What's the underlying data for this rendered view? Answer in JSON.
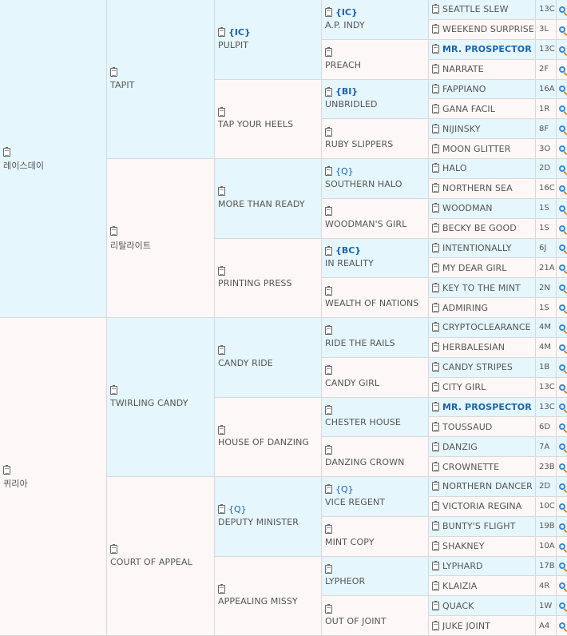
{
  "pedigree": {
    "gen1": [
      {
        "name": "레이스데이",
        "tag": ""
      },
      {
        "name": "퀴리아",
        "tag": ""
      }
    ],
    "gen2": [
      {
        "name": "TAPIT",
        "tag": ""
      },
      {
        "name": "리탈라이트",
        "tag": ""
      },
      {
        "name": "TWIRLING CANDY",
        "tag": ""
      },
      {
        "name": "COURT OF APPEAL",
        "tag": ""
      }
    ],
    "gen3": [
      {
        "name": "PULPIT",
        "tag": "{IC}"
      },
      {
        "name": "TAP YOUR HEELS",
        "tag": ""
      },
      {
        "name": "MORE THAN READY",
        "tag": ""
      },
      {
        "name": "PRINTING PRESS",
        "tag": ""
      },
      {
        "name": "CANDY RIDE",
        "tag": ""
      },
      {
        "name": "HOUSE OF DANZING",
        "tag": ""
      },
      {
        "name": "DEPUTY MINISTER",
        "tag": "{Q}"
      },
      {
        "name": "APPEALING MISSY",
        "tag": ""
      }
    ],
    "gen4": [
      {
        "name": "A.P. INDY",
        "tag": "{IC}"
      },
      {
        "name": "PREACH",
        "tag": ""
      },
      {
        "name": "UNBRIDLED",
        "tag": "{BI}"
      },
      {
        "name": "RUBY SLIPPERS",
        "tag": ""
      },
      {
        "name": "SOUTHERN HALO",
        "tag": "{Q}"
      },
      {
        "name": "WOODMAN'S GIRL",
        "tag": ""
      },
      {
        "name": "IN REALITY",
        "tag": "{BC}"
      },
      {
        "name": "WEALTH OF NATIONS",
        "tag": ""
      },
      {
        "name": "RIDE THE RAILS",
        "tag": ""
      },
      {
        "name": "CANDY GIRL",
        "tag": ""
      },
      {
        "name": "CHESTER HOUSE",
        "tag": ""
      },
      {
        "name": "DANZING CROWN",
        "tag": ""
      },
      {
        "name": "VICE REGENT",
        "tag": "{Q}"
      },
      {
        "name": "MINT COPY",
        "tag": ""
      },
      {
        "name": "LYPHEOR",
        "tag": ""
      },
      {
        "name": "OUT OF JOINT",
        "tag": ""
      }
    ],
    "gen5": [
      {
        "name": "SEATTLE SLEW",
        "code": "13C"
      },
      {
        "name": "WEEKEND SURPRISE",
        "code": "3L"
      },
      {
        "name": "MR. PROSPECTOR",
        "code": "13C",
        "highlight": true
      },
      {
        "name": "NARRATE",
        "code": "2F"
      },
      {
        "name": "FAPPIANO",
        "code": "16A"
      },
      {
        "name": "GANA FACIL",
        "code": "1R"
      },
      {
        "name": "NIJINSKY",
        "code": "8F"
      },
      {
        "name": "MOON GLITTER",
        "code": "3O"
      },
      {
        "name": "HALO",
        "code": "2D"
      },
      {
        "name": "NORTHERN SEA",
        "code": "16C"
      },
      {
        "name": "WOODMAN",
        "code": "1S"
      },
      {
        "name": "BECKY BE GOOD",
        "code": "1S"
      },
      {
        "name": "INTENTIONALLY",
        "code": "6J"
      },
      {
        "name": "MY DEAR GIRL",
        "code": "21A"
      },
      {
        "name": "KEY TO THE MINT",
        "code": "2N"
      },
      {
        "name": "ADMIRING",
        "code": "1S"
      },
      {
        "name": "CRYPTOCLEARANCE",
        "code": "4M"
      },
      {
        "name": "HERBALESIAN",
        "code": "4M"
      },
      {
        "name": "CANDY STRIPES",
        "code": "1B"
      },
      {
        "name": "CITY GIRL",
        "code": "13C"
      },
      {
        "name": "MR. PROSPECTOR",
        "code": "13C",
        "highlight": true
      },
      {
        "name": "TOUSSAUD",
        "code": "6D"
      },
      {
        "name": "DANZIG",
        "code": "7A"
      },
      {
        "name": "CROWNETTE",
        "code": "23B"
      },
      {
        "name": "NORTHERN DANCER",
        "code": "2D"
      },
      {
        "name": "VICTORIA REGINA",
        "code": "10C"
      },
      {
        "name": "BUNTY'S FLIGHT",
        "code": "19B"
      },
      {
        "name": "SHAKNEY",
        "code": "10A"
      },
      {
        "name": "LYPHARD",
        "code": "17B"
      },
      {
        "name": "KLAIZIA",
        "code": "4R"
      },
      {
        "name": "QUACK",
        "code": "1W"
      },
      {
        "name": "JUKE JOINT",
        "code": "A4"
      }
    ]
  },
  "icons": {
    "document": "clipboard-icon",
    "search": "magnifier-icon"
  },
  "colors": {
    "male_bg": "#e5f6fd",
    "female_bg": "#fdf7f7",
    "highlight": "#1b64a8"
  }
}
